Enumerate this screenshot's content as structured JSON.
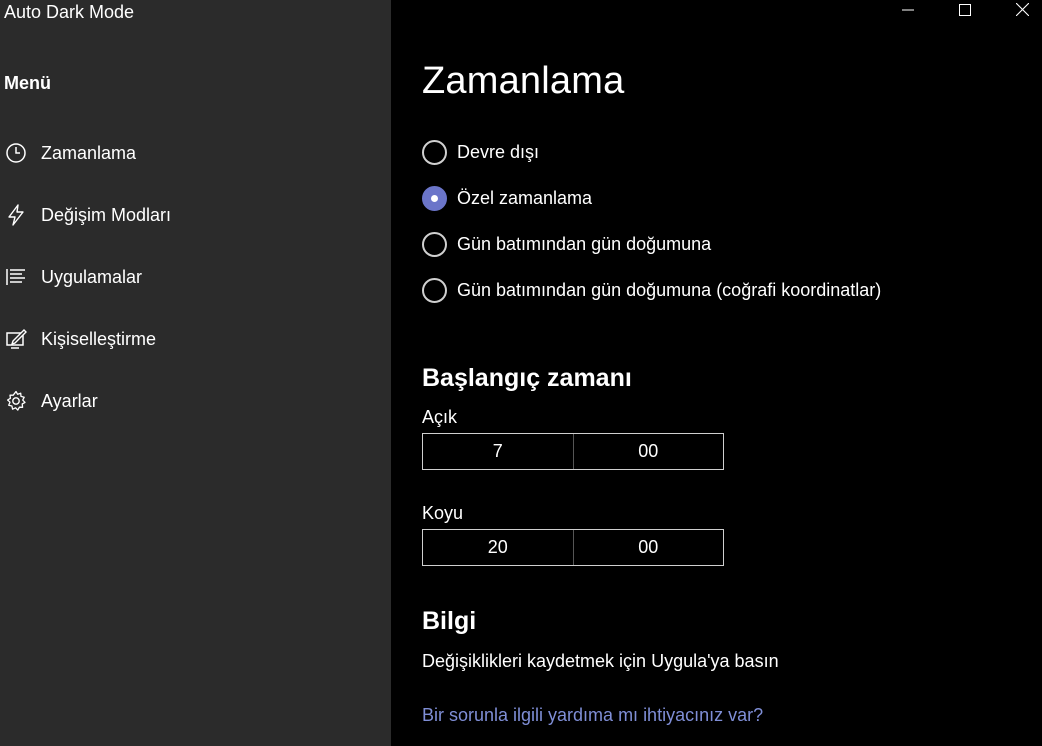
{
  "app": {
    "title": "Auto Dark Mode"
  },
  "sidebar": {
    "heading": "Menü",
    "items": [
      {
        "label": "Zamanlama",
        "icon": "clock-icon"
      },
      {
        "label": "Değişim Modları",
        "icon": "lightning-icon"
      },
      {
        "label": "Uygulamalar",
        "icon": "list-icon"
      },
      {
        "label": "Kişiselleştirme",
        "icon": "edit-display-icon"
      },
      {
        "label": "Ayarlar",
        "icon": "gear-icon"
      }
    ]
  },
  "main": {
    "title": "Zamanlama",
    "schedule_options": [
      {
        "label": "Devre dışı",
        "checked": false
      },
      {
        "label": "Özel zamanlama",
        "checked": true
      },
      {
        "label": "Gün batımından gün doğumuna",
        "checked": false
      },
      {
        "label": "Gün batımından gün doğumuna (coğrafi koordinatlar)",
        "checked": false
      }
    ],
    "start_time": {
      "title": "Başlangıç zamanı",
      "light": {
        "label": "Açık",
        "hour": "7",
        "minute": "00"
      },
      "dark": {
        "label": "Koyu",
        "hour": "20",
        "minute": "00"
      }
    },
    "info": {
      "title": "Bilgi",
      "text": "Değişiklikleri kaydetmek için Uygula'ya basın",
      "help_link": "Bir sorunla ilgili yardıma mı ihtiyacınız var?"
    }
  },
  "colors": {
    "accent": "#6b75c9",
    "link": "#7f8ed6",
    "sidebar_bg": "#2b2b2b",
    "main_bg": "#000000"
  }
}
